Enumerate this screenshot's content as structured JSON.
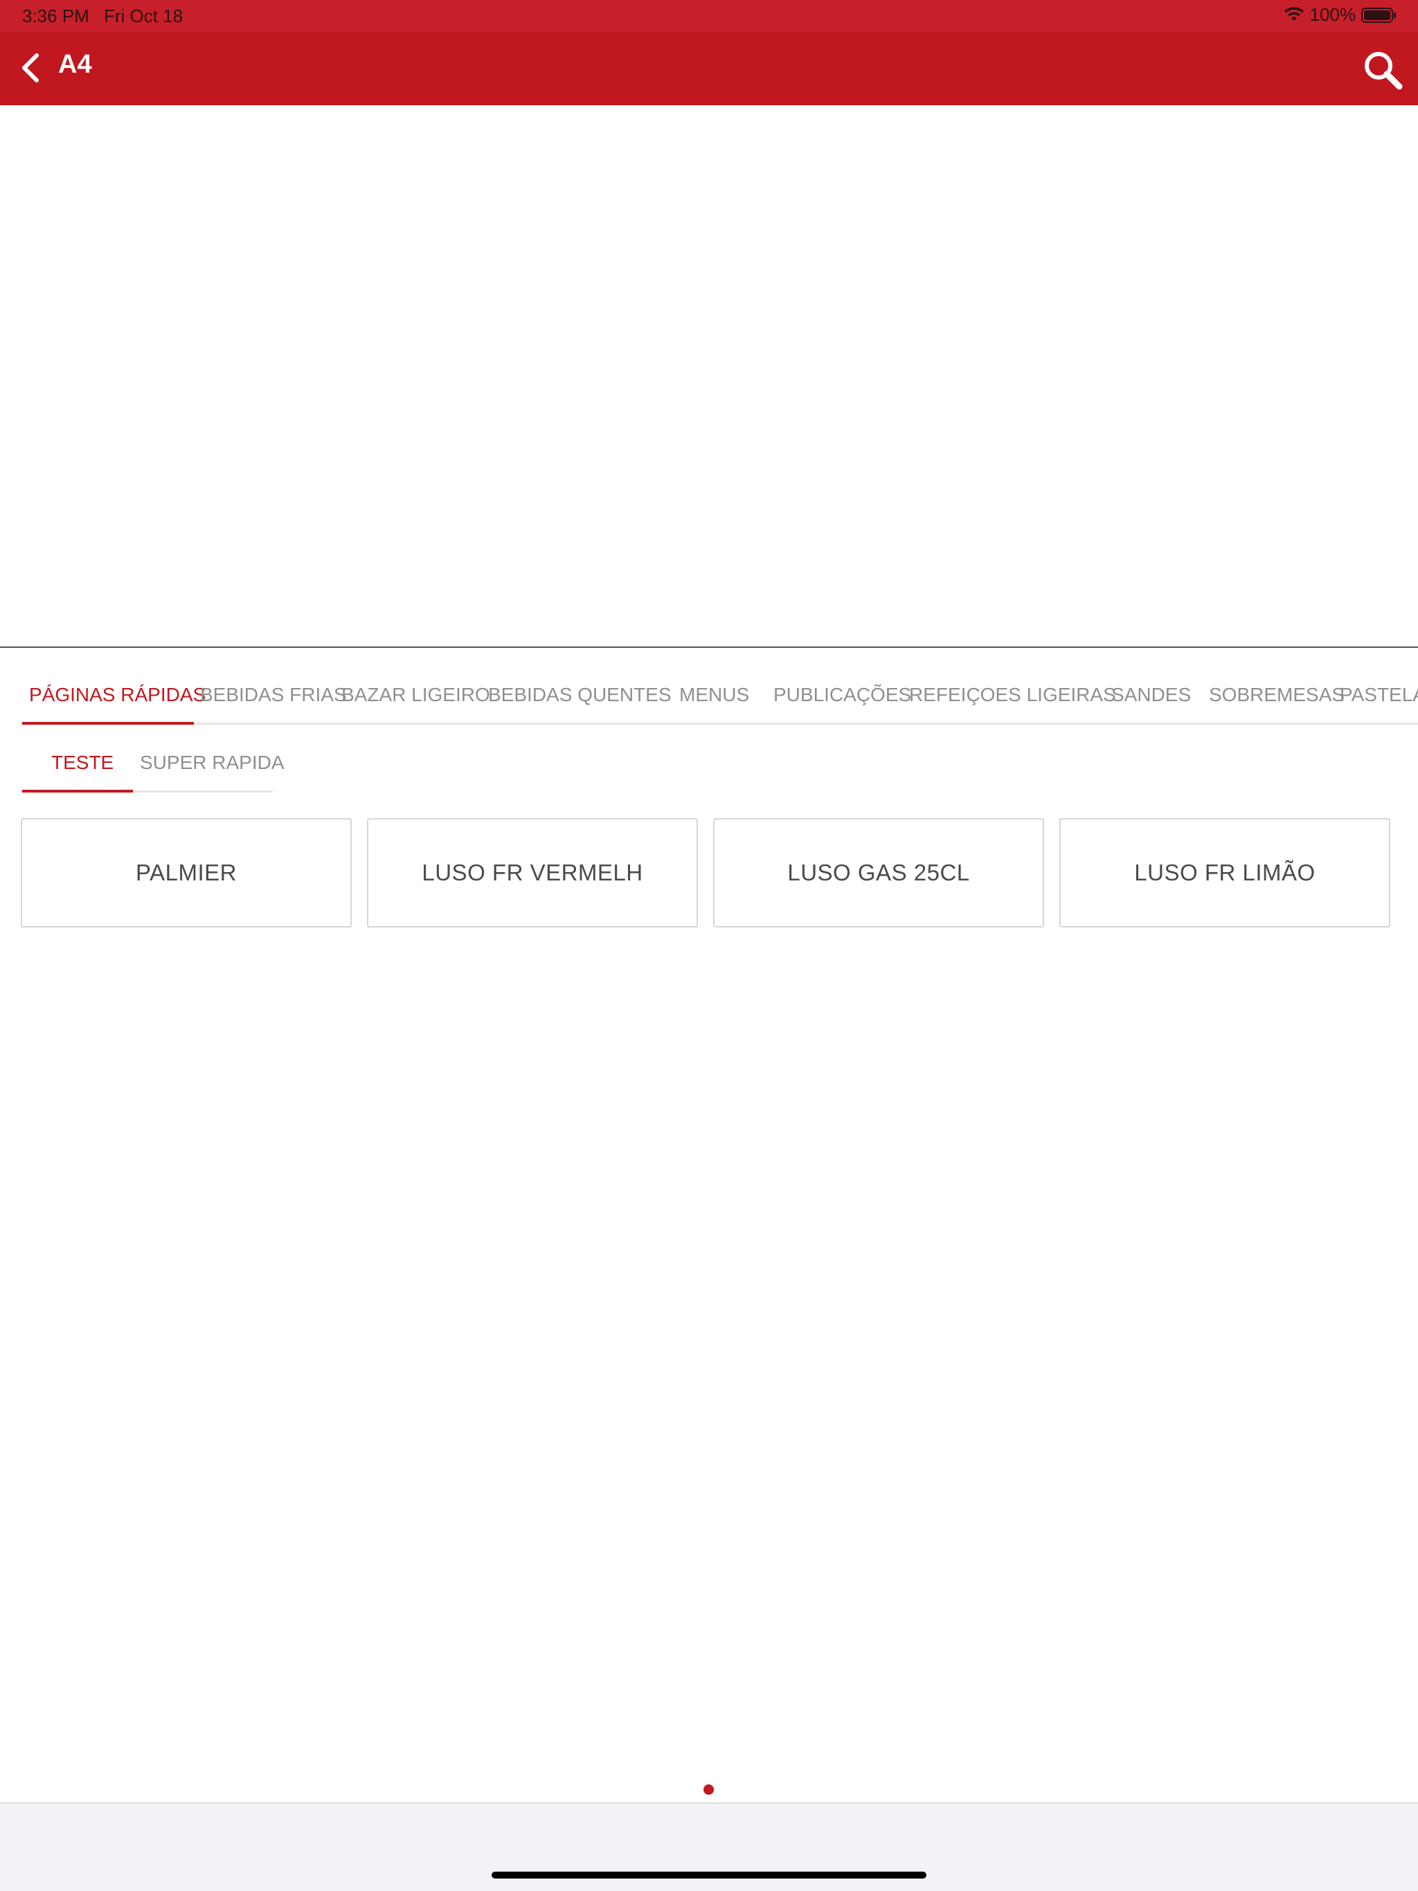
{
  "status_bar": {
    "time": "3:36 PM",
    "date": "Fri Oct 18",
    "battery": "100%"
  },
  "nav": {
    "title": "A4",
    "back_icon": "chevron-left-icon",
    "search_icon": "search-icon"
  },
  "category_tabs": [
    {
      "label": "PÁGINAS RÁPIDAS",
      "active": true
    },
    {
      "label": "BEBIDAS FRIAS",
      "active": false
    },
    {
      "label": "BAZAR LIGEIRO",
      "active": false
    },
    {
      "label": "BEBIDAS QUENTES",
      "active": false
    },
    {
      "label": "MENUS",
      "active": false
    },
    {
      "label": "PUBLICAÇÕES",
      "active": false
    },
    {
      "label": "REFEIÇOES LIGEIRAS",
      "active": false
    },
    {
      "label": "SANDES",
      "active": false
    },
    {
      "label": "SOBREMESAS",
      "active": false
    },
    {
      "label": "PASTELARIA",
      "active": false
    }
  ],
  "sub_tabs": [
    {
      "label": "TESTE",
      "active": true
    },
    {
      "label": "SUPER RAPIDA",
      "active": false
    }
  ],
  "products": [
    {
      "label": "PALMIER"
    },
    {
      "label": "LUSO FR VERMELH"
    },
    {
      "label": "LUSO GAS 25CL"
    },
    {
      "label": "LUSO FR LIMÃO"
    }
  ],
  "colors": {
    "brand_red": "#c1171f",
    "status_red": "#c8202a",
    "inactive_text": "#8f8f8f",
    "tile_text": "#4a4a4a"
  }
}
